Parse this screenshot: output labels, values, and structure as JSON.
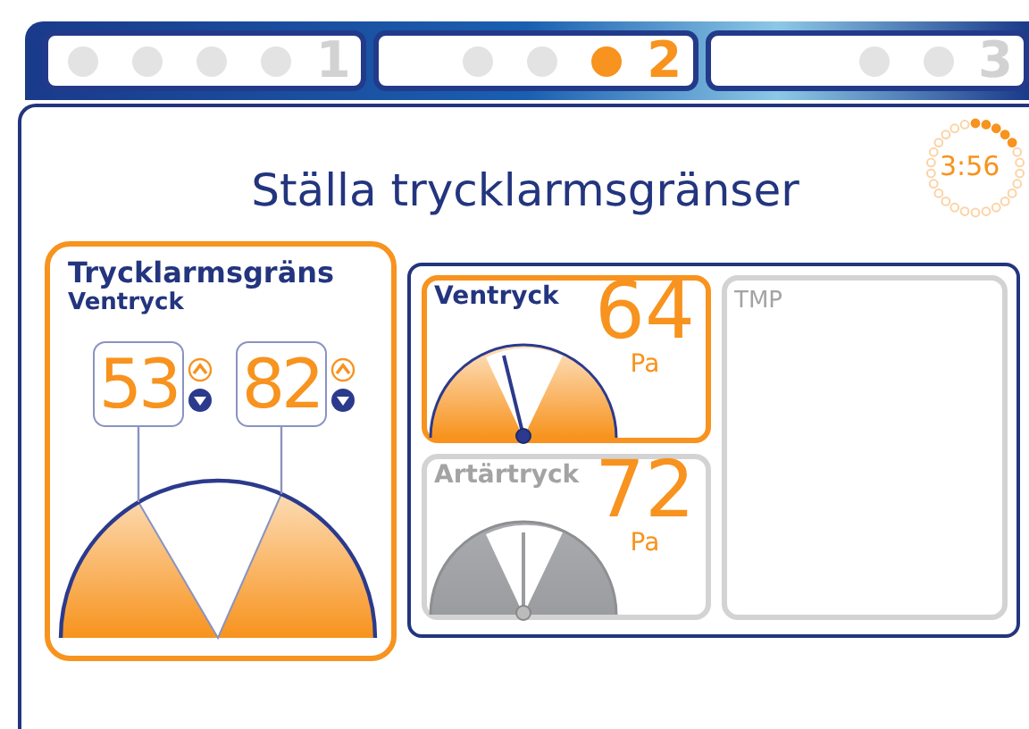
{
  "steps": [
    {
      "number": "1",
      "selected": false,
      "dots": [
        {
          "active": false
        },
        {
          "active": false
        },
        {
          "active": false
        },
        {
          "active": false
        }
      ]
    },
    {
      "number": "2",
      "selected": true,
      "dots": [
        {
          "active": false
        },
        {
          "active": false
        },
        {
          "active": true
        }
      ]
    },
    {
      "number": "3",
      "selected": false,
      "dots": [
        {
          "active": false
        },
        {
          "active": false
        }
      ]
    }
  ],
  "title": "Ställa trycklarmsgränser",
  "timer": {
    "text": "3:56",
    "level": 0.2
  },
  "limit_card": {
    "title": "Trycklarmsgräns",
    "subtitle": "Ventryck",
    "values": [
      "53",
      "82"
    ]
  },
  "pressures": [
    {
      "label": "Ventryck",
      "value": "64",
      "unit": "Pa",
      "selected": true
    },
    {
      "label": "Artärtryck",
      "value": "72",
      "unit": "Pa",
      "selected": false
    }
  ],
  "tmp": {
    "label": "TMP"
  }
}
